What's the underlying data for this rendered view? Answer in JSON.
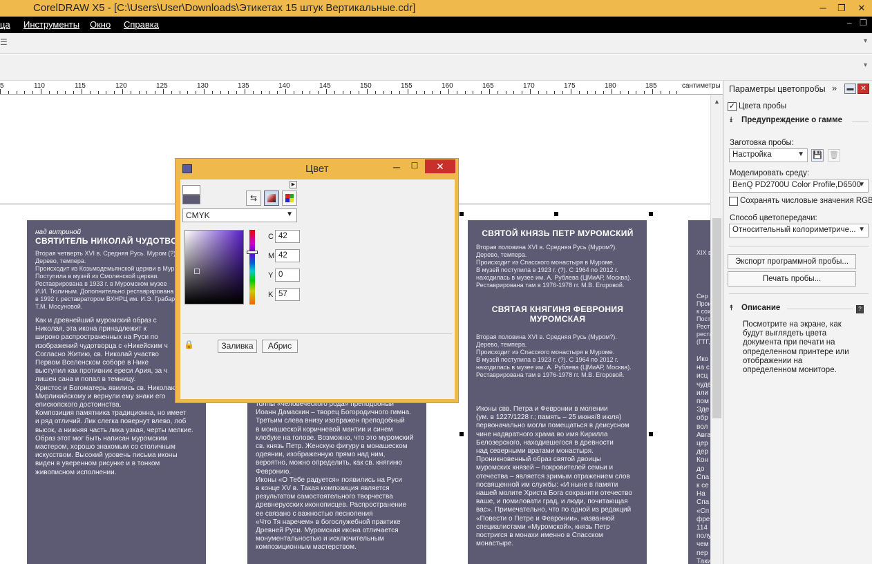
{
  "window": {
    "title": "CorelDRAW X5 - [C:\\Users\\User\\Downloads\\Этикетах 15 штук Вертикальные.cdr]",
    "min": "─",
    "max": "❐",
    "close": "✕"
  },
  "menu": {
    "items": [
      "ца",
      "Инструменты",
      "Окно",
      "Справка"
    ],
    "doc_min": "‒",
    "doc_restore": "❐",
    "doc_close": "✕"
  },
  "ruler": {
    "ticks": [
      "5",
      "110",
      "115",
      "120",
      "125",
      "130",
      "135",
      "140",
      "145",
      "150",
      "155",
      "160",
      "165",
      "170",
      "175",
      "180",
      "185"
    ],
    "unit": "сантиметры"
  },
  "labels": {
    "label1": {
      "subtitle": "над витриной",
      "title": "СВЯТИТЕЛЬ НИКОЛАЙ ЧУДОТВО",
      "meta": [
        "Вторая четверть XVI в. Средняя Русь. Муром (?).",
        "Дерево, темпера.",
        "Происходит из Козьмодемьянской церкви в Мур",
        "Поступила в музей из Смоленской церкви.",
        "Реставрирована в 1933 г. в Муромском музее",
        "И.И. Тюлиным. Дополнительно реставрирована",
        "в 1992 г. реставратором ВХНРЦ им. И.Э. Грабар",
        "Т.М. Мосуновой."
      ],
      "body": [
        "Как и древнейший муромский образ с",
        "Николая, эта икона принадлежит к",
        "широко распространенных на Руси по",
        "изображений чудотворца с «Никейским ч",
        "Согласно Житию, св. Николай участво",
        "Первом Вселенском соборе в Нике",
        "выступил как противник ереси Ария, за ч",
        "лишен сана и попал в темницу.",
        "Христос и Богоматерь явились св. Николаю",
        "Мирликийскому и вернули ему знаки его",
        "епископского достоинства.",
        "Композиция памятника традиционна, но имеет",
        "и ряд отличий. Лик слегка повернут влево, лоб",
        "высок, а нижняя часть лика узкая, черты мелкие.",
        "Образ этот мог быть написан муромским",
        "мастером, хорошо знакомым со столичным",
        "искусством. Высокий уровень письма иконы",
        "виден в уверенном рисунке и в тонком",
        "живописном исполнении."
      ]
    },
    "label2": {
      "body": [
        "толпы «человеческого рода» преподобный",
        "Иоанн Дамаскин – творец Богородичного гимна.",
        "Третьим слева внизу изображен преподобный",
        "в монашеской коричневой мантии и синем",
        "клобуке на голове. Возможно, что это муромский",
        "св. князь Петр. Женскую фигуру в монашеском",
        "одеянии, изображенную прямо над ним,",
        "вероятно, можно определить, как св. княгиню",
        "Февронию.",
        "Иконы «О Тебе радуется» появились на Руси",
        "в конце XV в. Такая композиция является",
        "результатом самостоятельного творчества",
        "древнерусских иконописцев. Распространение",
        "ее связано с важностью песнопения",
        "«Что Тя наречем» в богослужебной практике",
        "Древней Руси. Муромская икона отличается",
        "монументальностью и исключительным",
        "композиционным мастерством."
      ]
    },
    "label3": {
      "title1": "СВЯТОЙ КНЯЗЬ ПЕТР МУРОМСКИЙ",
      "meta1": [
        "Вторая половина XVI в. Средняя Русь (Муром?).",
        "Дерево, темпера.",
        "Происходит из Спасского монастыря в Муроме.",
        "В музей поступила в 1923 г. (?). С 1964 по 2012 г.",
        "находилась в музее им. А. Рублева (ЦМиАР, Москва).",
        "Реставрирована там в 1976-1978 гг. М.В. Егоровой."
      ],
      "title2a": "СВЯТАЯ КНЯГИНЯ ФЕВРОНИЯ",
      "title2b": "МУРОМСКАЯ",
      "meta2": [
        "Вторая половина XVI в. Средняя Русь (Муром?).",
        "Дерево, темпера.",
        "Происходит из Спасского монастыря в Муроме.",
        "В музей поступила в 1923 г. (?). С 1964 по 2012 г.",
        "находилась в музее им. А. Рублева (ЦМиАР, Москва).",
        "Реставрирована там в 1976-1978 гг. М.В. Егоровой."
      ],
      "body": [
        "Иконы свв. Петра и Февронии в молении",
        "(ум. в 1227/1228 г.; память – 25 июня/8 июля)",
        "первоначально могли помещаться в деисусном",
        "чине надвратного храма во имя Кирилла",
        "Белозерского, находившегося в древности",
        "над северными вратами монастыря.",
        "Проникновенный образ святой двоицы",
        "муромских князей – покровителей семьи и",
        "отечества – является зримым отражением слов",
        "посвященной им службы: «И ныне в памяти",
        "нашей молите Христа Бога сохранити отечество",
        "ваше, и помиловати град, и люди, почитающая",
        "вас». Примечательно, что по одной из редакций",
        "«Повести о Петре и Февронии», названной",
        "специалистами «Муромской», князь Петр",
        "постригся в монахи именно в Спасском",
        "монастыре."
      ]
    },
    "label4": {
      "lines": [
        "XIX в",
        "Сер",
        "Прои",
        "к сох",
        "Пост",
        "Рест",
        "реста",
        "(ГТГ,",
        "Ико",
        "на с",
        "исц",
        "чуде",
        "или",
        "пом",
        "Эде",
        "обр",
        "вол",
        "Авга",
        "цер",
        "дер",
        "Кон",
        "до",
        "Спа",
        "к се",
        "На",
        "Спа",
        "«Сп",
        "фре",
        "114",
        "полу",
        "чем",
        "пер",
        "Таки"
      ]
    }
  },
  "docker": {
    "title": "Параметры цветопробы",
    "proof_colors": "Цвета пробы",
    "gamut_warning": "Предупреждение о гамме",
    "preset_label": "Заготовка пробы:",
    "preset_value": "Настройка",
    "simulate_label": "Моделировать среду:",
    "simulate_value": "BenQ PD2700U Color Profile,D6500",
    "preserve_rgb": "Сохранять числовые значения RGB",
    "rendering_label": "Способ цветопередачи:",
    "rendering_value": "Относительный колориметриче...",
    "export_button": "Экспорт программной пробы...",
    "print_button": "Печать пробы...",
    "desc_title": "Описание",
    "desc_lines": [
      "Посмотрите на экране, как",
      "будут выглядеть цвета",
      "документа при печати на",
      "определенном принтере или",
      "отображении на",
      "определенном мониторе."
    ]
  },
  "color_dialog": {
    "title": "Цвет",
    "model": "CMYK",
    "c_label": "C",
    "c_value": "42",
    "m_label": "M",
    "m_value": "42",
    "y_label": "Y",
    "y_value": "0",
    "k_label": "K",
    "k_value": "57",
    "fill_button": "Заливка",
    "outline_button": "Абрис",
    "current_color": "#5d5a73"
  },
  "colors": {
    "titlebar": "#f0b94c",
    "menubar": "#000000",
    "label_bg": "#5d5a73"
  }
}
